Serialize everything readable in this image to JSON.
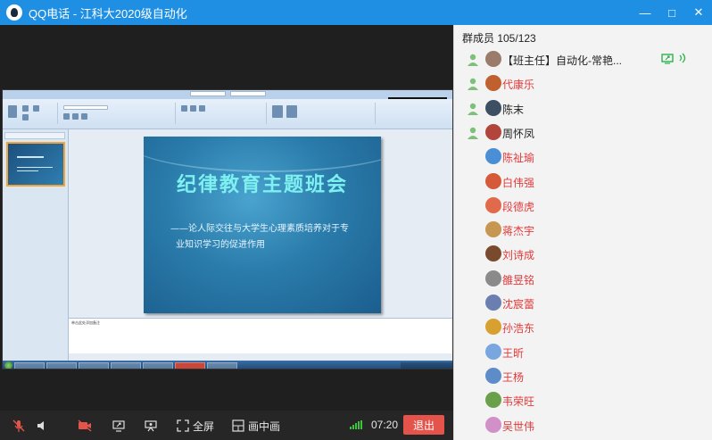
{
  "window": {
    "title": "QQ电话 - 江科大2020级自动化",
    "min_glyph": "—",
    "max_glyph": "□",
    "close_glyph": "✕"
  },
  "shared_screen": {
    "slide_title": "纪律教育主题班会",
    "slide_subtitle_line1": "——论人际交往与大学生心理素质培养对于专",
    "slide_subtitle_line2": "业知识学习的促进作用",
    "notes_placeholder": "单击此处添加备注",
    "mini_window_text": "QQ - 江科大 ..."
  },
  "toolbar": {
    "mic_icon": "mic-muted-icon",
    "speaker_icon": "speaker-icon",
    "camera_icon": "camera-off-icon",
    "share_icon": "share-screen-icon",
    "demo_icon": "presentation-icon",
    "fullscreen_label": "全屏",
    "pip_label": "画中画",
    "timer": "07:20",
    "exit_label": "退出"
  },
  "members": {
    "header": "群成员 105/123",
    "list": [
      {
        "name": "【班主任】自动化-常艳...",
        "highlight": false,
        "host": true
      },
      {
        "name": "代康乐",
        "highlight": true,
        "host": true
      },
      {
        "name": "陈末",
        "highlight": false,
        "host": true
      },
      {
        "name": "周怀凤",
        "highlight": false,
        "host": true
      },
      {
        "name": "陈祉瑜",
        "highlight": true,
        "host": false
      },
      {
        "name": "白伟强",
        "highlight": true,
        "host": false
      },
      {
        "name": "段德虎",
        "highlight": true,
        "host": false
      },
      {
        "name": "蒋杰宇",
        "highlight": true,
        "host": false
      },
      {
        "name": "刘诗成",
        "highlight": true,
        "host": false
      },
      {
        "name": "雒昱铭",
        "highlight": true,
        "host": false
      },
      {
        "name": "沈宸蕾",
        "highlight": true,
        "host": false
      },
      {
        "name": "孙浩东",
        "highlight": true,
        "host": false
      },
      {
        "name": "王昕",
        "highlight": true,
        "host": false
      },
      {
        "name": "王杨",
        "highlight": true,
        "host": false
      },
      {
        "name": "韦荣旺",
        "highlight": true,
        "host": false
      },
      {
        "name": "吴世伟",
        "highlight": true,
        "host": false
      }
    ]
  },
  "colors": {
    "titlebar": "#1e8fe3",
    "exit": "#e5544b",
    "highlight_name": "#e03b3b",
    "signal": "#3bc43b"
  }
}
